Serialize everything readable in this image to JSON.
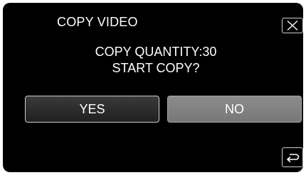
{
  "dialog": {
    "title": "COPY VIDEO",
    "message_lines": [
      "COPY QUANTITY:30",
      "START COPY?"
    ]
  },
  "buttons": {
    "yes_label": "YES",
    "no_label": "NO"
  },
  "icons": {
    "close": "close-icon",
    "back": "return-arrow-icon"
  },
  "colors": {
    "background": "#000000",
    "text": "#ffffff",
    "yes_button": "#2a2a2a",
    "no_button": "#828282"
  }
}
